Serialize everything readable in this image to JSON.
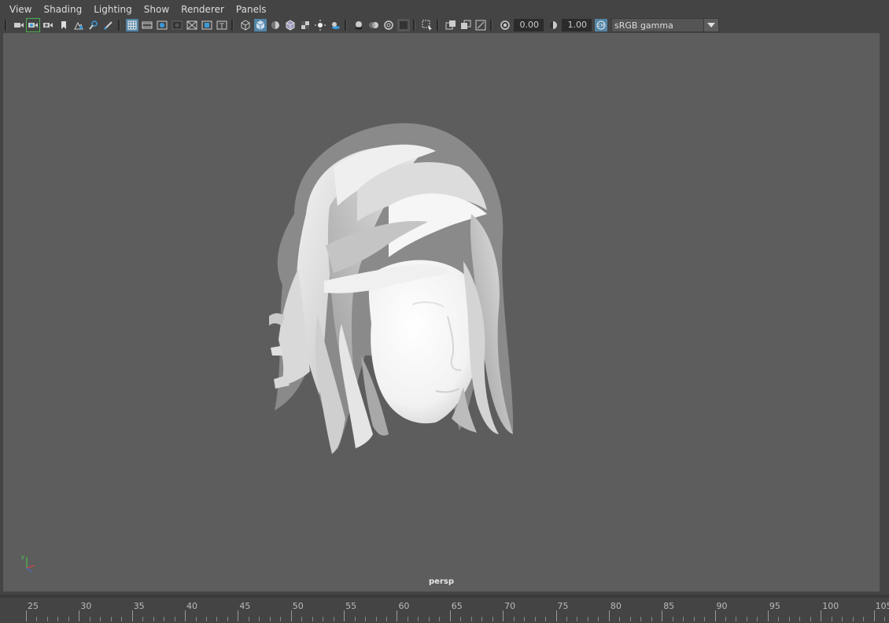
{
  "menubar": {
    "items": [
      "View",
      "Shading",
      "Lighting",
      "Show",
      "Renderer",
      "Panels"
    ]
  },
  "toolbar": {
    "exposure_value": "0.00",
    "gamma_value": "1.00",
    "color_space": "sRGB gamma",
    "icons": [
      "select-camera-icon",
      "camera-attributes-icon",
      "bookmarks-icon",
      "image-plane-icon",
      "2d-pan-zoom-icon",
      "grease-pencil-icon",
      "grid-icon",
      "film-gate-icon",
      "resolution-gate-icon",
      "gate-mask-icon",
      "field-chart-icon",
      "safe-action-icon",
      "safe-title-icon",
      "wireframe-icon",
      "smooth-shade-icon",
      "use-default-material-icon",
      "wireframe-on-shaded-icon",
      "textured-icon",
      "use-all-lights-icon",
      "shadows-icon",
      "screen-space-ao-icon",
      "motion-blur-icon",
      "multisample-aa-icon",
      "depth-of-field-icon",
      "isolate-select-icon",
      "xray-icon",
      "xray-active-components-icon",
      "xray-joints-icon",
      "exposure-icon",
      "gamma-icon",
      "view-transform-icon"
    ]
  },
  "viewport": {
    "camera_label": "persp",
    "background": "#5d5d5d",
    "axis": {
      "y": "y"
    }
  },
  "timeslider": {
    "ticks": [
      25,
      30,
      35,
      40,
      45,
      50,
      55,
      60,
      65,
      70,
      75,
      80,
      85,
      90,
      95,
      100,
      "105"
    ]
  },
  "colors": {
    "accent": "#5285a6",
    "panel": "#444444",
    "viewport": "#5d5d5d"
  }
}
